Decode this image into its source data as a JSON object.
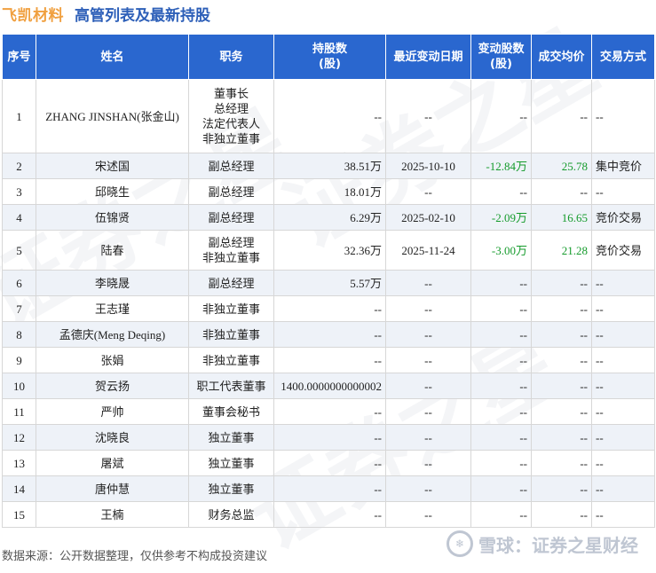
{
  "header": {
    "company": "飞凯材料",
    "title": "高管列表及最新持股"
  },
  "columns": [
    "序号",
    "姓名",
    "职务",
    "持股数\n(股)",
    "最近变动日期",
    "变动股数\n(股)",
    "成交均价",
    "交易方式"
  ],
  "rows": [
    {
      "no": "1",
      "name": "ZHANG JINSHAN(张金山)",
      "position": "董事长\n总经理\n法定代表人\n非独立董事",
      "shares": "--",
      "date": "--",
      "change": "--",
      "price": "--",
      "method": "--"
    },
    {
      "no": "2",
      "name": "宋述国",
      "position": "副总经理",
      "shares": "38.51万",
      "date": "2025-10-10",
      "change": "-12.84万",
      "price": "25.78",
      "method": "集中竞价"
    },
    {
      "no": "3",
      "name": "邱晓生",
      "position": "副总经理",
      "shares": "18.01万",
      "date": "--",
      "change": "--",
      "price": "--",
      "method": "--"
    },
    {
      "no": "4",
      "name": "伍锦贤",
      "position": "副总经理",
      "shares": "6.29万",
      "date": "2025-02-10",
      "change": "-2.09万",
      "price": "16.65",
      "method": "竞价交易"
    },
    {
      "no": "5",
      "name": "陆春",
      "position": "副总经理\n非独立董事",
      "shares": "32.36万",
      "date": "2025-11-24",
      "change": "-3.00万",
      "price": "21.28",
      "method": "竞价交易"
    },
    {
      "no": "6",
      "name": "李晓晟",
      "position": "副总经理",
      "shares": "5.57万",
      "date": "--",
      "change": "--",
      "price": "--",
      "method": "--"
    },
    {
      "no": "7",
      "name": "王志瑾",
      "position": "非独立董事",
      "shares": "--",
      "date": "--",
      "change": "--",
      "price": "--",
      "method": "--"
    },
    {
      "no": "8",
      "name": "孟德庆(Meng Deqing)",
      "position": "非独立董事",
      "shares": "--",
      "date": "--",
      "change": "--",
      "price": "--",
      "method": "--"
    },
    {
      "no": "9",
      "name": "张娟",
      "position": "非独立董事",
      "shares": "--",
      "date": "--",
      "change": "--",
      "price": "--",
      "method": "--"
    },
    {
      "no": "10",
      "name": "贺云扬",
      "position": "职工代表董事",
      "shares": "1400.0000000000002",
      "date": "--",
      "change": "--",
      "price": "--",
      "method": "--"
    },
    {
      "no": "11",
      "name": "严帅",
      "position": "董事会秘书",
      "shares": "--",
      "date": "--",
      "change": "--",
      "price": "--",
      "method": "--"
    },
    {
      "no": "12",
      "name": "沈晓良",
      "position": "独立董事",
      "shares": "--",
      "date": "--",
      "change": "--",
      "price": "--",
      "method": "--"
    },
    {
      "no": "13",
      "name": "屠斌",
      "position": "独立董事",
      "shares": "--",
      "date": "--",
      "change": "--",
      "price": "--",
      "method": "--"
    },
    {
      "no": "14",
      "name": "唐仲慧",
      "position": "独立董事",
      "shares": "--",
      "date": "--",
      "change": "--",
      "price": "--",
      "method": "--"
    },
    {
      "no": "15",
      "name": "王楠",
      "position": "财务总监",
      "shares": "--",
      "date": "--",
      "change": "--",
      "price": "--",
      "method": "--"
    }
  ],
  "footer": {
    "source": "数据来源：公开数据整理，仅供参考不构成投资建议",
    "brand": "雪球：证券之星财经"
  },
  "watermark": "证券之星",
  "colors": {
    "header_bg": "#2a67cf",
    "company": "#f0a040",
    "title": "#2d5fb8",
    "negative": "#e0202a",
    "positive": "#159b2c",
    "alt_row": "#eef2f8"
  }
}
